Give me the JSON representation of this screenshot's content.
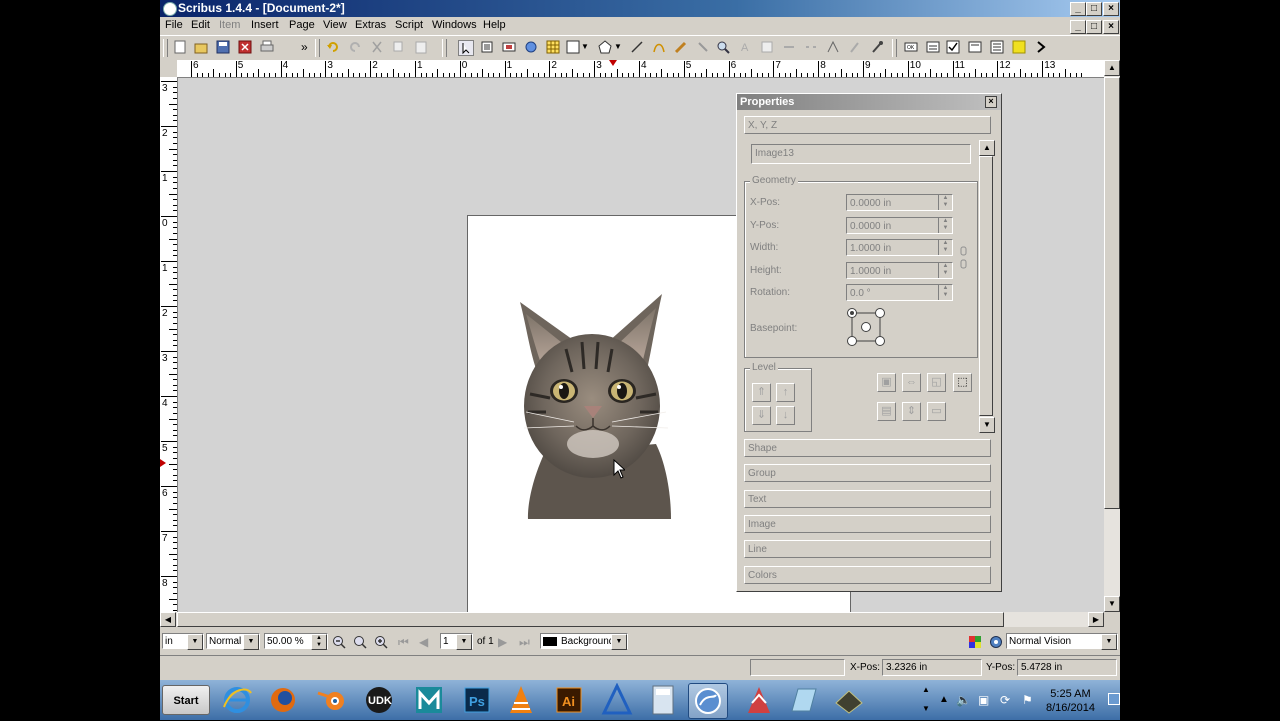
{
  "window": {
    "title": "Scribus 1.4.4 - [Document-2*]"
  },
  "menu": [
    "File",
    "Edit",
    "Item",
    "Insert",
    "Page",
    "View",
    "Extras",
    "Script",
    "Windows",
    "Help"
  ],
  "menu_disabled": [
    "Item"
  ],
  "ruler": {
    "h_labels": [
      "6",
      "5",
      "4",
      "3",
      "2",
      "1",
      "0",
      "1",
      "2",
      "3",
      "4",
      "5",
      "6",
      "7",
      "8",
      "9",
      "10",
      "11",
      "12",
      "13"
    ],
    "v_labels": [
      "3",
      "2",
      "1",
      "0",
      "1",
      "2",
      "3",
      "4",
      "5",
      "6",
      "7",
      "8"
    ]
  },
  "properties": {
    "title": "Properties",
    "xyz_label": "X, Y, Z",
    "item_name": "Image13",
    "geometry_label": "Geometry",
    "xpos_label": "X-Pos:",
    "xpos": "0.0000 in",
    "ypos_label": "Y-Pos:",
    "ypos": "0.0000 in",
    "width_label": "Width:",
    "width": "1.0000 in",
    "height_label": "Height:",
    "height": "1.0000 in",
    "rotation_label": "Rotation:",
    "rotation": "0.0 °",
    "basepoint_label": "Basepoint:",
    "level_label": "Level",
    "sections": [
      "Shape",
      "Group",
      "Text",
      "Image",
      "Line",
      "Colors"
    ]
  },
  "nav": {
    "unit": "in",
    "mode": "Normal",
    "zoom": "50.00 %",
    "page": "1",
    "of_pages": "of 1",
    "layer": "Background",
    "vision": "Normal Vision"
  },
  "status": {
    "xpos_label": "X-Pos:",
    "xpos": "3.2326 in",
    "ypos_label": "Y-Pos:",
    "ypos": "5.4728 in"
  },
  "taskbar": {
    "start": "Start",
    "apps": [
      "internet-explorer",
      "firefox",
      "blender",
      "udk",
      "maya",
      "photoshop",
      "vlc",
      "illustrator",
      "3d-app",
      "calculator",
      "app-blue",
      "mudbox",
      "app-glass",
      "terminal"
    ],
    "udk_label": "UDK",
    "ps_label": "Ps",
    "ai_label": "Ai",
    "time": "5:25 AM",
    "date": "8/16/2014"
  },
  "colors": {
    "title_blue": "#0a246a",
    "accent_red": "#c00000"
  }
}
